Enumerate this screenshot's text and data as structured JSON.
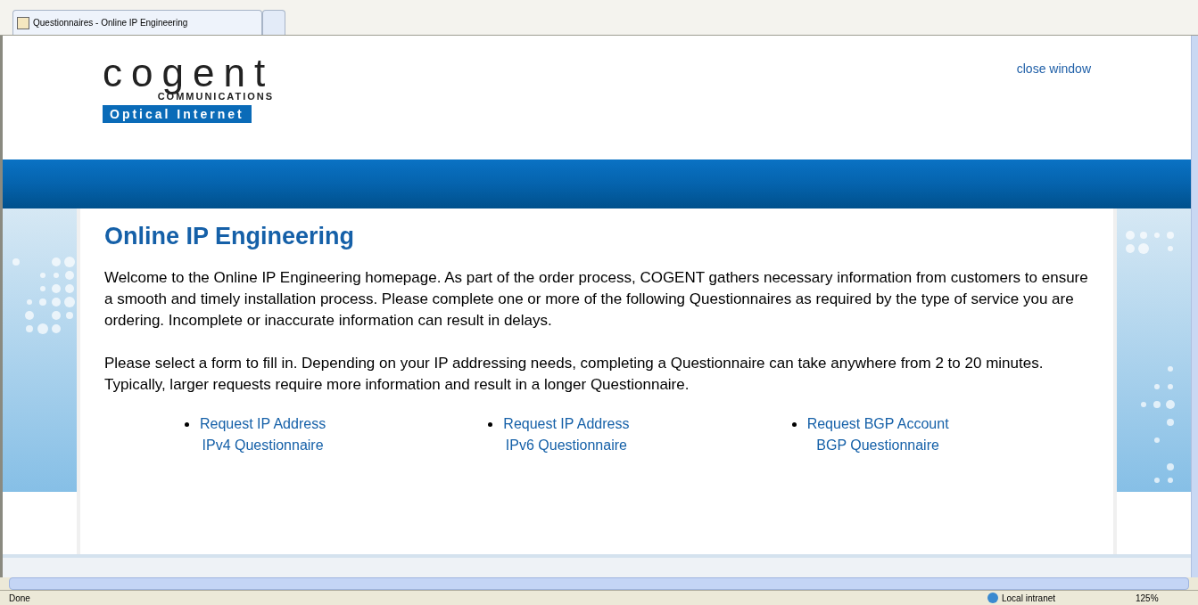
{
  "browser_tabs": [
    {
      "title": "Questionnaires - Online IP Engineering",
      "selected": true
    },
    {
      "selected": false
    }
  ],
  "logo": {
    "word": "cogent",
    "subtitle": "COMMUNICATIONS",
    "tagline": "Optical Internet"
  },
  "close_link": "close window",
  "heading": "Online IP Engineering",
  "paragraphs": [
    "Welcome to the Online IP Engineering homepage. As part of the order process, COGENT gathers necessary information from customers to ensure a smooth and timely installation process. Please complete one or more of the following Questionnaires as required by the type of service you are ordering. Incomplete or inaccurate information can result in delays.",
    "Please select a form to fill in. Depending on your IP addressing needs, completing a Questionnaire can take anywhere from 2 to 20 minutes. Typically, larger requests require more information and result in a longer Questionnaire."
  ],
  "links": [
    {
      "title": "Request IP Address",
      "subtitle": "IPv4 Questionnaire"
    },
    {
      "title": "Request IP Address",
      "subtitle": "IPv6 Questionnaire"
    },
    {
      "title": "Request BGP Account",
      "subtitle": "BGP Questionnaire"
    }
  ],
  "status_bar": {
    "status": "Done",
    "zone": "Local intranet",
    "zoom": "125%"
  }
}
